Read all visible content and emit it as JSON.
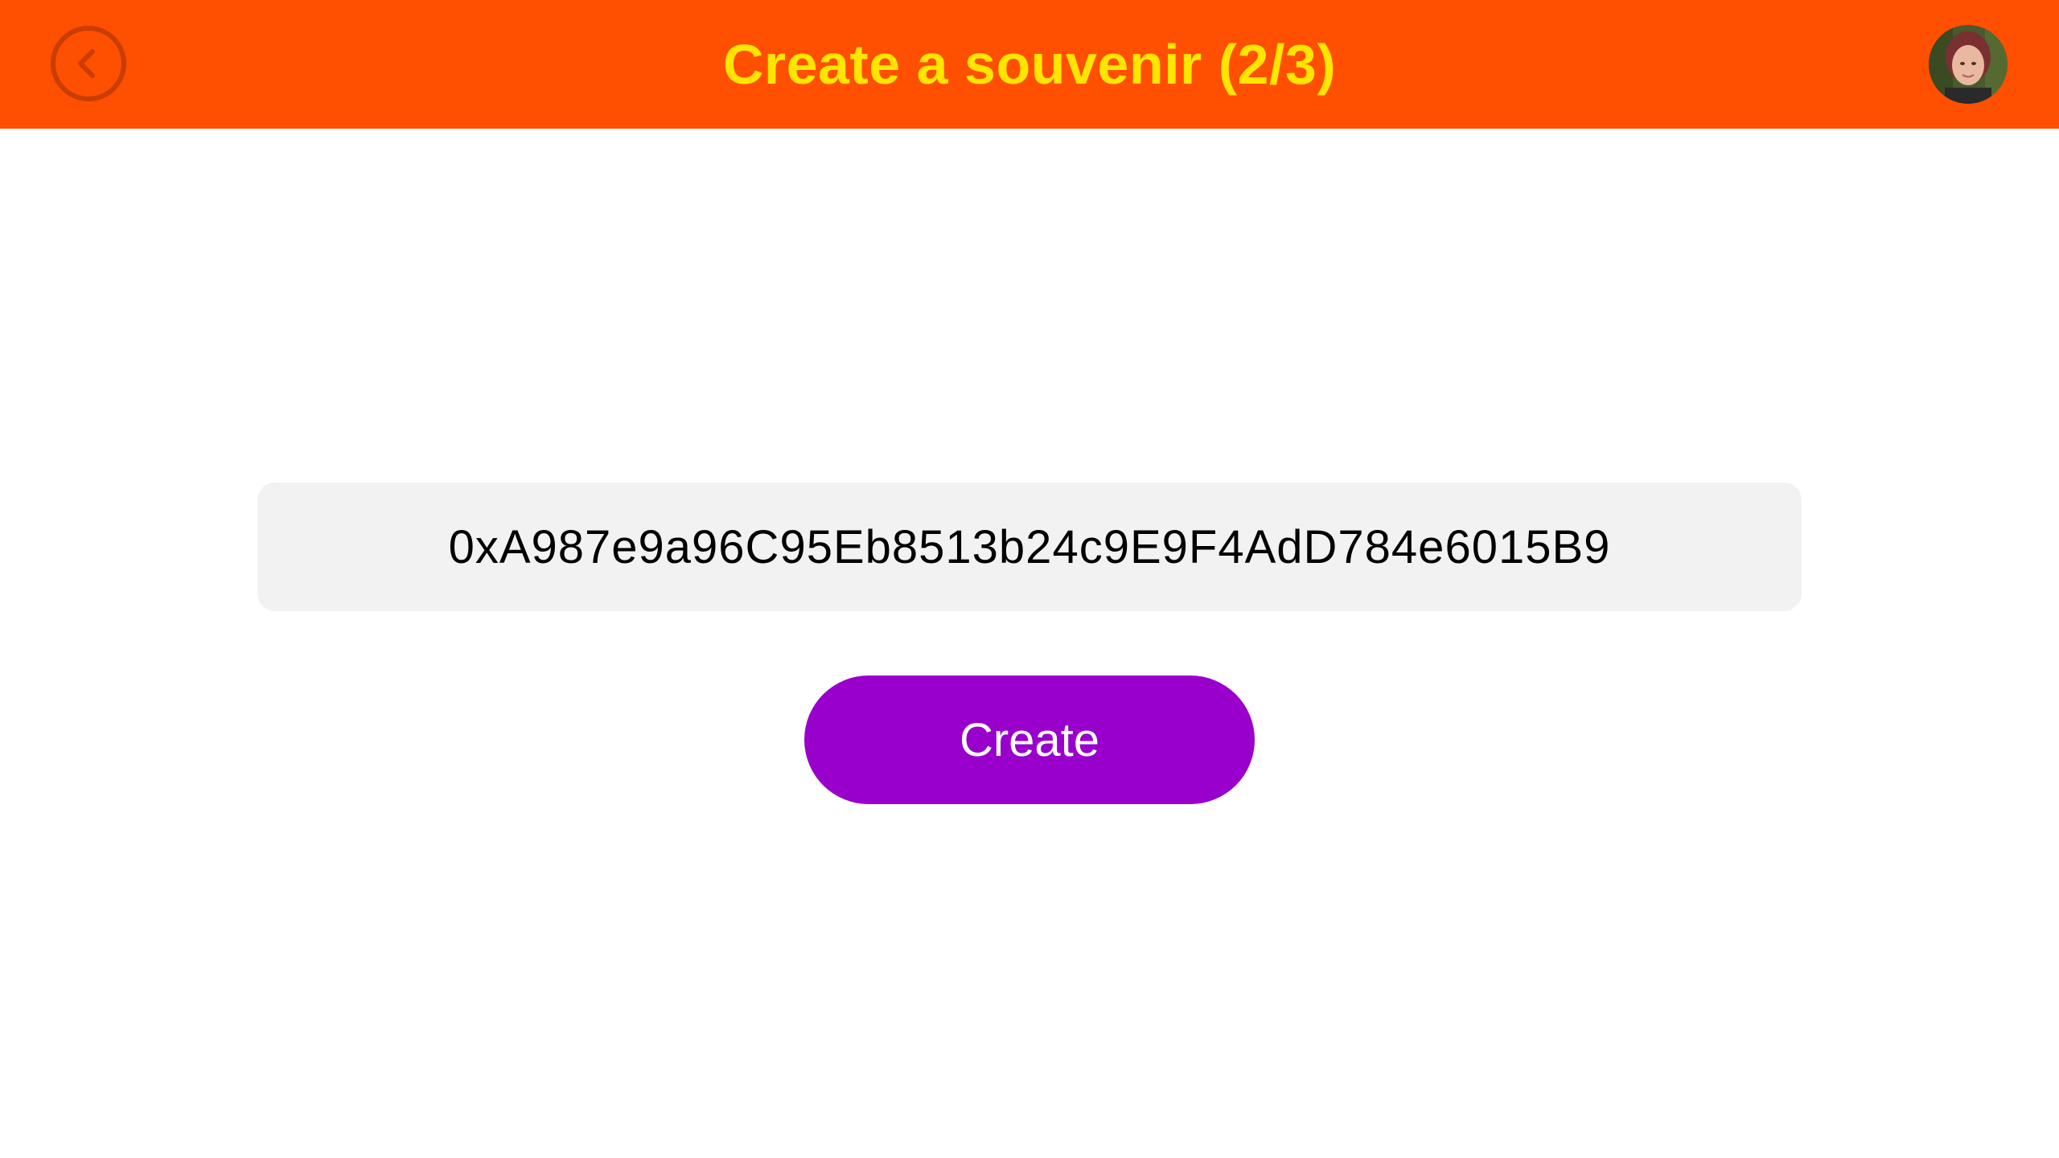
{
  "header": {
    "title": "Create a souvenir (2/3)",
    "back_icon": "chevron-left-circle-icon",
    "avatar_icon": "user-avatar",
    "background_color": "#ff4f00",
    "title_color": "#ffe500"
  },
  "main": {
    "address": "0xA987e9a96C95Eb8513b24c9E9F4AdD784e6015B9",
    "create_label": "Create",
    "button_color": "#9900cc"
  }
}
